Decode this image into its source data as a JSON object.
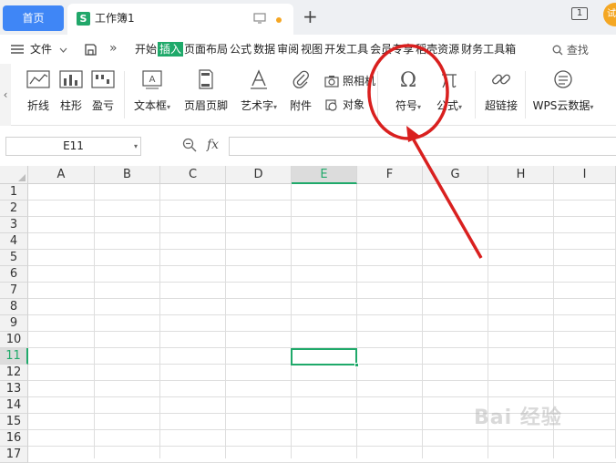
{
  "tabs": {
    "home_label": "首页",
    "doc_title": "工作簿1",
    "doc_icon_letter": "S",
    "new_tab": "+",
    "page_indicator": "1",
    "avatar_text": "试"
  },
  "menu": {
    "file_label": "文件",
    "more_chevron": "»",
    "items": [
      "开始",
      "插入",
      "页面布局",
      "公式",
      "数据",
      "审阅",
      "视图",
      "开发工具",
      "会员专享",
      "稻壳资源",
      "财务工具箱"
    ],
    "active_item": "插入",
    "search_label": "查找"
  },
  "ribbon": {
    "left_arrow": "‹",
    "line_chart": "折线",
    "column_chart": "柱形",
    "win_loss": "盈亏",
    "textbox": "文本框",
    "header_footer": "页眉页脚",
    "wordart": "艺术字",
    "attachment": "附件",
    "camera": "照相机",
    "object": "对象",
    "symbol": "符号",
    "formula": "公式",
    "hyperlink": "超链接",
    "wps_cloud": "WPS云数据"
  },
  "formula_bar": {
    "cell_ref": "E11",
    "fx": "fx",
    "content": ""
  },
  "grid": {
    "columns": [
      "A",
      "B",
      "C",
      "D",
      "E",
      "F",
      "G",
      "H",
      "I"
    ],
    "rows": [
      "1",
      "2",
      "3",
      "4",
      "5",
      "6",
      "7",
      "8",
      "9",
      "10",
      "11",
      "12",
      "13",
      "14",
      "15",
      "16",
      "17"
    ],
    "selected_column": "E",
    "selected_row": "11"
  },
  "watermark": "Bai 经验",
  "colors": {
    "accent_green": "#1fa96a",
    "home_tab_blue": "#3f86f6",
    "annotation_red": "#d9201f"
  }
}
